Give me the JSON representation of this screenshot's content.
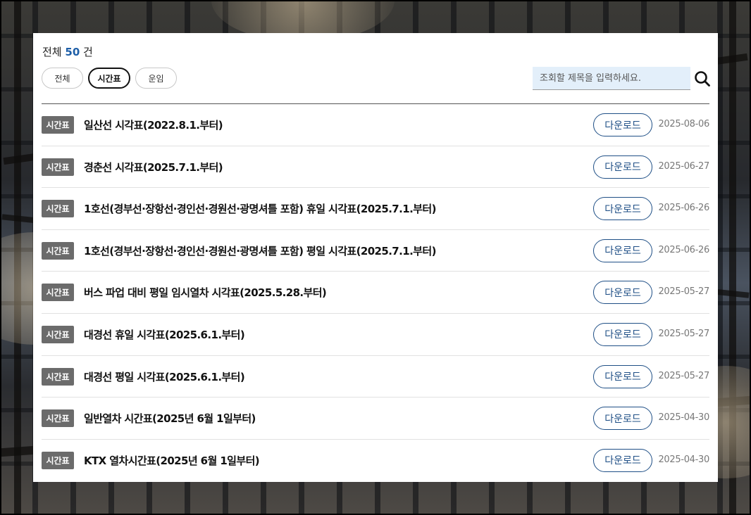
{
  "summary": {
    "prefix": "전체",
    "count": "50",
    "suffix": "건"
  },
  "tabs": [
    {
      "label": "전체",
      "active": false
    },
    {
      "label": "시간표",
      "active": true
    },
    {
      "label": "운임",
      "active": false
    }
  ],
  "search": {
    "placeholder": "조회할 제목을 입력하세요.",
    "value": ""
  },
  "list": {
    "download_label": "다운로드",
    "items": [
      {
        "badge": "시간표",
        "title": "일산선 시각표(2022.8.1.부터)",
        "date": "2025-08-06"
      },
      {
        "badge": "시간표",
        "title": "경춘선 시각표(2025.7.1.부터)",
        "date": "2025-06-27"
      },
      {
        "badge": "시간표",
        "title": "1호선(경부선·장항선·경인선·경원선·광명셔틀 포함) 휴일 시각표(2025.7.1.부터)",
        "date": "2025-06-26"
      },
      {
        "badge": "시간표",
        "title": "1호선(경부선·장항선·경인선·경원선·광명셔틀 포함) 평일 시각표(2025.7.1.부터)",
        "date": "2025-06-26"
      },
      {
        "badge": "시간표",
        "title": "버스 파업 대비 평일 임시열차 시각표(2025.5.28.부터)",
        "date": "2025-05-27"
      },
      {
        "badge": "시간표",
        "title": "대경선 휴일 시각표(2025.6.1.부터)",
        "date": "2025-05-27"
      },
      {
        "badge": "시간표",
        "title": "대경선 평일 시각표(2025.6.1.부터)",
        "date": "2025-05-27"
      },
      {
        "badge": "시간표",
        "title": "일반열차 시간표(2025년 6월 1일부터)",
        "date": "2025-04-30"
      },
      {
        "badge": "시간표",
        "title": "KTX 열차시간표(2025년 6월 1일부터)",
        "date": "2025-04-30"
      }
    ]
  },
  "colors": {
    "accent": "#1e5fa8",
    "button_border": "#1f4f86",
    "badge_bg": "#6b6b6b",
    "search_bg": "#e3effa"
  },
  "icons": {
    "search": "search-icon"
  }
}
